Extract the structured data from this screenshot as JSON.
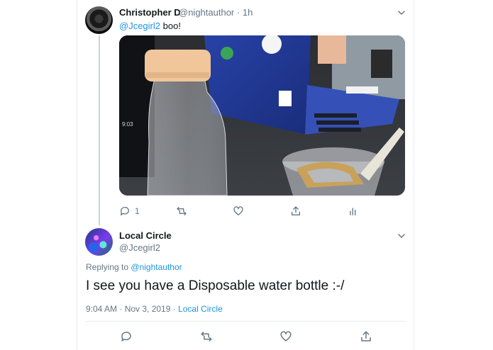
{
  "tweet": {
    "author_name": "Christopher D",
    "author_handle": "@nightauthor",
    "separator": "·",
    "time": "1h",
    "mention": "@Jcegirl2",
    "text": "boo!",
    "image_alt_icons": [
      "photo-water-bottle"
    ],
    "actions": {
      "reply_count": "1"
    }
  },
  "reply": {
    "author_name": "Local Circle",
    "author_handle": "@Jcegirl2",
    "replying_prefix": "Replying to",
    "replying_to": "@nightauthor",
    "text": "I see you have a Disposable water bottle :-/",
    "timestamp": "9:04 AM · Nov 3, 2019 ·",
    "source": "Local Circle"
  },
  "colors": {
    "link": "#1b95e0",
    "secondary": "#657786",
    "primary_text": "#14171a",
    "border": "#e6ecf0"
  }
}
